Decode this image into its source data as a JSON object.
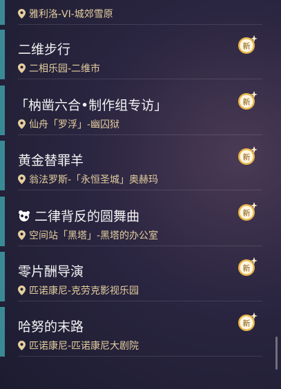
{
  "quests": [
    {
      "title": "",
      "location": "雅利洛-VI-城郊雪原",
      "is_new": false
    },
    {
      "title": "二维步行",
      "location": "二相乐园-二维市",
      "is_new": true
    },
    {
      "title": "「枘凿六合•制作组专访」",
      "location": "仙舟「罗浮」-幽囚狱",
      "is_new": true
    },
    {
      "title": "黄金替罪羊",
      "location": "翁法罗斯-「永恒圣城」奥赫玛",
      "is_new": true
    },
    {
      "title": "二律背反的圆舞曲",
      "location": "空间站「黑塔」-黑塔的办公室",
      "is_new": true,
      "icon": "panda-icon"
    },
    {
      "title": "零片酬导演",
      "location": "匹诺康尼-克劳克影视乐园",
      "is_new": true
    },
    {
      "title": "哈努的末路",
      "location": "匹诺康尼-匹诺康尼大剧院",
      "is_new": true
    }
  ],
  "badge_label": "新",
  "colors": {
    "accent_stripe": "#3a8a95",
    "location_text": "#e6cf9f",
    "badge": "#e8b64a"
  }
}
